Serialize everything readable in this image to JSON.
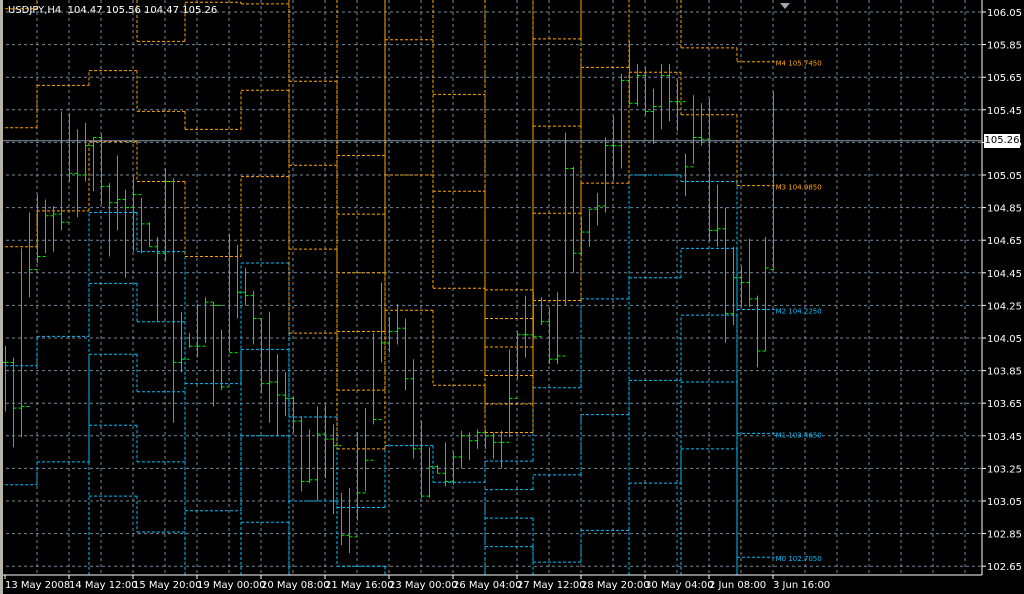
{
  "header": {
    "symbol": "USDJPY,H4",
    "open": "104.47",
    "high": "105.56",
    "low": "104.47",
    "close": "105.26"
  },
  "current_price_label": "105.26",
  "colors": {
    "background": "#000000",
    "grid": "#778899",
    "bars": "#00e600",
    "upper_levels": "#ffa500",
    "lower_levels": "#00bfff",
    "axis": "#ffffff",
    "price_line": "#8899a6"
  },
  "chart_data": {
    "type": "ohlc",
    "symbol": "USDJPY",
    "timeframe": "H4",
    "ylim": [
      102.65,
      106.05
    ],
    "y_ticks": [
      "106.05",
      "105.85",
      "105.65",
      "105.45",
      "105.25",
      "105.05",
      "104.85",
      "104.65",
      "104.45",
      "104.25",
      "104.05",
      "103.85",
      "103.65",
      "103.45",
      "103.25",
      "103.05",
      "102.85",
      "102.65"
    ],
    "x_ticks": [
      "13 May 2008",
      "14 May 12:00",
      "15 May 20:00",
      "19 May 00:00",
      "20 May 08:00",
      "21 May 16:00",
      "23 May 00:00",
      "26 May 04:00",
      "27 May 12:00",
      "28 May 20:00",
      "30 May 04:00",
      "2 Jun 08:00",
      "3 Jun 16:00"
    ],
    "x_tick_every_bars": 8,
    "grid": true,
    "high": [
      104.0,
      103.93,
      104.6,
      104.82,
      104.93,
      104.9,
      104.86,
      105.44,
      105.43,
      105.33,
      105.37,
      105.28,
      105.3,
      105.0,
      105.17,
      104.96,
      105.04,
      104.91,
      104.76,
      104.67,
      105.09,
      105.03,
      104.21,
      104.08,
      104.26,
      104.3,
      104.27,
      104.1,
      104.69,
      104.62,
      104.48,
      104.34,
      104.17,
      104.21,
      103.95,
      103.84,
      103.69,
      103.57,
      103.49,
      103.63,
      103.64,
      103.52,
      103.1,
      103.13,
      103.47,
      103.62,
      104.08,
      104.39,
      104.18,
      104.26,
      104.17,
      103.92,
      103.54,
      103.38,
      103.27,
      103.41,
      103.35,
      103.48,
      103.47,
      103.49,
      103.49,
      103.47,
      103.48,
      103.98,
      104.09,
      104.31,
      104.33,
      104.3,
      104.23,
      104.33,
      105.31,
      105.1,
      104.79,
      104.84,
      104.94,
      105.28,
      105.41,
      105.67,
      105.87,
      105.73,
      105.71,
      105.58,
      105.73,
      105.73,
      105.63,
      105.18,
      105.54,
      105.49,
      105.52,
      104.99,
      104.85,
      104.61,
      104.49,
      104.66,
      104.31,
      104.67,
      105.56
    ],
    "low": [
      103.6,
      103.38,
      103.44,
      104.3,
      104.51,
      104.57,
      104.58,
      104.71,
      105.01,
      104.79,
      105.01,
      104.95,
      104.87,
      104.55,
      104.71,
      104.42,
      104.58,
      104.57,
      104.61,
      104.15,
      104.52,
      103.53,
      103.84,
      103.99,
      103.93,
      104.02,
      103.63,
      103.73,
      103.96,
      104.17,
      104.25,
      104.01,
      103.71,
      103.53,
      103.45,
      103.57,
      103.47,
      103.11,
      103.16,
      103.05,
      103.19,
      102.97,
      102.78,
      102.73,
      102.93,
      103.11,
      103.52,
      103.9,
      103.96,
      104.01,
      103.73,
      103.31,
      103.07,
      103.07,
      103.22,
      103.14,
      103.15,
      103.25,
      103.3,
      103.37,
      103.37,
      103.31,
      103.25,
      103.44,
      103.8,
      103.93,
      104.04,
      104.13,
      103.89,
      103.89,
      104.25,
      104.45,
      104.55,
      104.61,
      104.74,
      104.82,
      105.02,
      105.09,
      105.48,
      105.47,
      105.42,
      105.24,
      105.33,
      105.38,
      105.32,
      104.92,
      105.12,
      105.23,
      104.65,
      104.61,
      104.02,
      104.13,
      104.24,
      104.24,
      103.87,
      103.97,
      104.47
    ],
    "close": [
      103.9,
      103.62,
      103.63,
      104.47,
      104.55,
      104.8,
      104.81,
      104.76,
      105.06,
      105.05,
      105.23,
      105.28,
      104.98,
      104.88,
      104.9,
      104.85,
      104.93,
      104.75,
      104.61,
      104.57,
      105.01,
      103.9,
      103.92,
      104.0,
      104.0,
      104.27,
      104.25,
      103.75,
      103.96,
      104.33,
      104.31,
      104.17,
      103.77,
      103.78,
      103.7,
      103.68,
      103.54,
      103.17,
      103.18,
      103.46,
      103.43,
      103.39,
      102.84,
      102.83,
      103.1,
      103.3,
      103.55,
      104.02,
      104.09,
      104.11,
      103.8,
      103.37,
      103.08,
      103.26,
      103.22,
      103.17,
      103.32,
      103.45,
      103.42,
      103.47,
      103.45,
      103.41,
      103.41,
      103.68,
      104.07,
      104.07,
      104.06,
      104.15,
      103.92,
      103.94,
      105.09,
      104.57,
      104.7,
      104.84,
      104.86,
      105.23,
      105.23,
      105.63,
      105.49,
      105.66,
      105.44,
      105.47,
      105.66,
      105.5,
      105.5,
      105.1,
      105.28,
      105.27,
      104.71,
      104.72,
      104.2,
      104.42,
      104.39,
      104.29,
      103.97,
      104.48,
      105.26
    ],
    "last_open": 104.47,
    "levels": {
      "note": "daily step levels M(k) = m0 + k*step; k<=2 lower colour, k>=3 upper colour",
      "segments": [
        {
          "start_bar": -0.6,
          "m0": 102.42,
          "step": 0.73
        },
        {
          "start_bar": 4,
          "m0": 102.52,
          "step": 0.77
        },
        {
          "start_bar": 10.5,
          "m0": 103.95,
          "step": 0.435
        },
        {
          "start_bar": 16.5,
          "m0": 103.72,
          "step": 0.43
        },
        {
          "start_bar": 22.5,
          "m0": 102.21,
          "step": 0.78
        },
        {
          "start_bar": 29.5,
          "m0": 103.45,
          "step": 0.53
        },
        {
          "start_bar": 35.5,
          "m0": 102.535,
          "step": 0.515
        },
        {
          "start_bar": 41.5,
          "m0": 102.29,
          "step": 0.36
        },
        {
          "start_bar": 47.5,
          "m0": 101.73,
          "step": 0.83
        },
        {
          "start_bar": 53.5,
          "m0": 101.975,
          "step": 0.595
        },
        {
          "start_bar": 60,
          "m0": 102.945,
          "step": 0.175
        },
        {
          "start_bar": 66,
          "m0": 102.675,
          "step": 0.535
        },
        {
          "start_bar": 72,
          "m0": 102.87,
          "step": 0.71
        },
        {
          "start_bar": 78,
          "m0": 103.79,
          "step": 0.63
        },
        {
          "start_bar": 84.5,
          "m0": 104.19,
          "step": 0.41
        },
        {
          "start_bar": 91.5,
          "m0": 102.705,
          "step": 0.76
        }
      ],
      "end_bar": 96.2,
      "labels": [
        {
          "text": "M4 105.7450",
          "price": 105.745,
          "kind": "upper"
        },
        {
          "text": "M3 104.9850",
          "price": 104.985,
          "kind": "upper"
        },
        {
          "text": "M2 104.2250",
          "price": 104.225,
          "kind": "lower"
        },
        {
          "text": "M1 103.4650",
          "price": 103.465,
          "kind": "lower"
        },
        {
          "text": "M0 102.7050",
          "price": 102.705,
          "kind": "lower"
        }
      ]
    }
  }
}
